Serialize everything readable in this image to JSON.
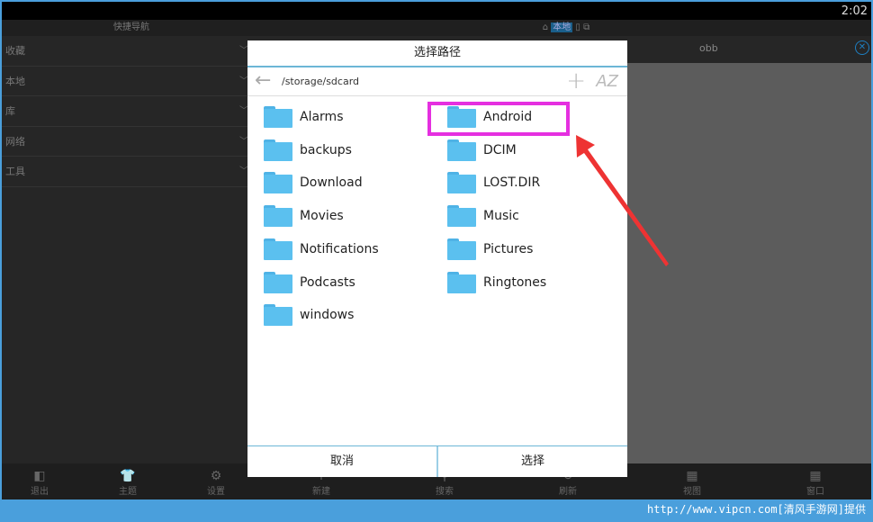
{
  "status": {
    "time": "2:02"
  },
  "left": {
    "header": "快捷导航",
    "items": [
      "收藏",
      "本地",
      "库",
      "网络",
      "工具"
    ]
  },
  "right": {
    "location": "本地",
    "tab": "obb"
  },
  "toolbar": [
    "退出",
    "主题",
    "设置",
    "新建",
    "搜索",
    "刷新",
    "视图",
    "窗口"
  ],
  "dialog": {
    "title": "选择路径",
    "path": "/storage/sdcard",
    "sort_label": "AZ",
    "folders_left": [
      "Alarms",
      "backups",
      "Download",
      "Movies",
      "Notifications",
      "Podcasts",
      "windows"
    ],
    "folders_right": [
      "Android",
      "DCIM",
      "LOST.DIR",
      "Music",
      "Pictures",
      "Ringtones"
    ],
    "cancel": "取消",
    "select": "选择"
  },
  "annotation": {
    "highlight_color": "#e52fe0",
    "arrow_color": "#ee3333"
  },
  "watermark": "http://www.vipcn.com[清风手游网]提供"
}
